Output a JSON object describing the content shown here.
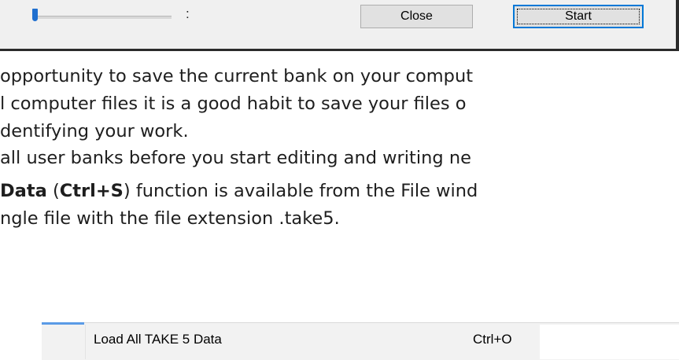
{
  "dialog": {
    "progress": 0,
    "time_label": ":",
    "close_label": "Close",
    "start_label": "Start"
  },
  "body": {
    "para1_lines": [
      "opportunity to save the current bank on your comput",
      "l computer files it is a good habit to save your files o",
      "dentifying your work."
    ],
    "para2": "all user banks before you start editing and writing ne",
    "para3_line1_bold1": "Data",
    "para3_line1_text1": " (",
    "para3_line1_bold2": "Ctrl+S",
    "para3_line1_text2": ") function is available from the File wind",
    "para3_line2": "ngle file with the file extension  .take5."
  },
  "menu": {
    "item_label": "Load All TAKE 5 Data",
    "item_shortcut": "Ctrl+O"
  },
  "colors": {
    "accent": "#0078d7",
    "slider_thumb": "#1f6fcf"
  }
}
